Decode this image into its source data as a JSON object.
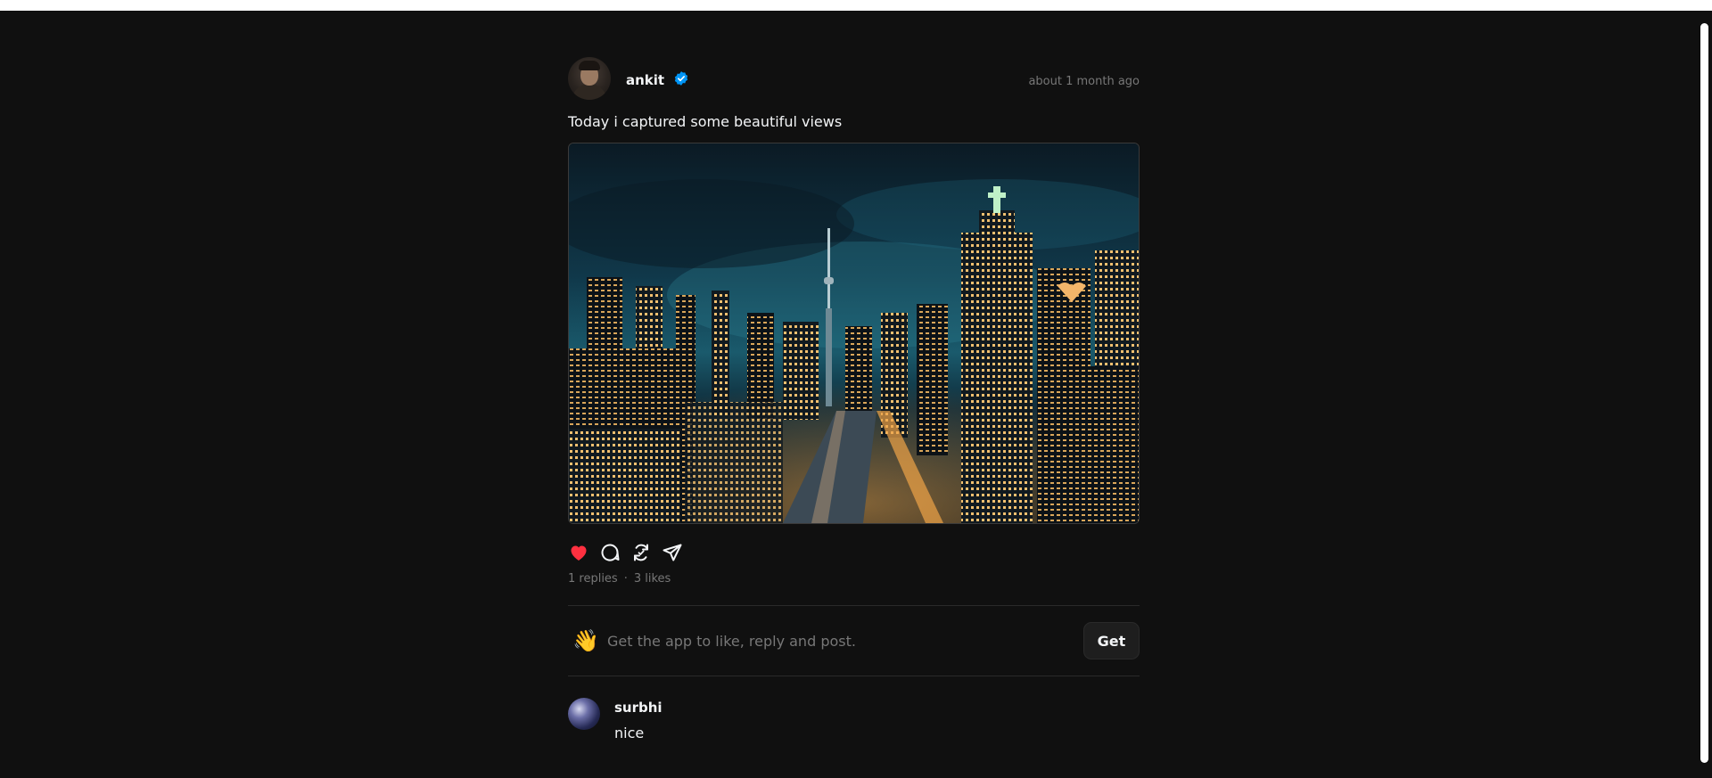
{
  "post": {
    "author": "ankit",
    "verified": true,
    "timestamp": "about 1 month ago",
    "text": "Today i captured some beautiful views",
    "image_alt": "night city skyline",
    "liked": true,
    "stats": {
      "replies": "1 replies",
      "separator": "·",
      "likes": "3 likes"
    }
  },
  "cta": {
    "text": "Get the app to like, reply and post.",
    "button_label": "Get"
  },
  "replies": [
    {
      "author": "surbhi",
      "text": "nice"
    }
  ],
  "colors": {
    "background": "#101010",
    "text_primary": "#f3f5f7",
    "text_secondary": "#777777",
    "like_red": "#ff3040",
    "verified_blue": "#0095f6"
  },
  "icons": {
    "like": "heart-icon",
    "reply": "comment-icon",
    "repost": "repost-icon",
    "share": "share-icon",
    "verified": "verified-badge-icon",
    "cta": "waving-hand-icon"
  }
}
